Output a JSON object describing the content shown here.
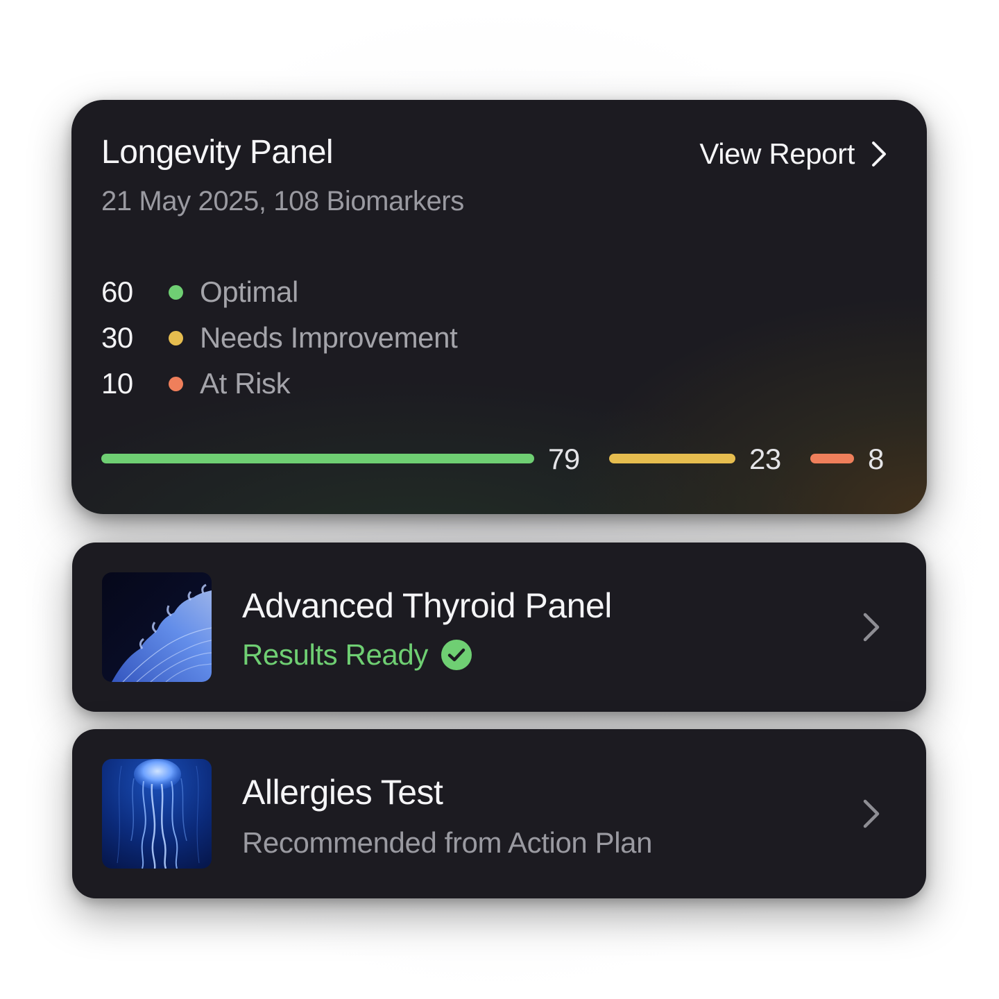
{
  "colors": {
    "optimal": "#6fcf73",
    "needs_improvement": "#e6bd4f",
    "at_risk": "#ef7f5b",
    "card_background": "#1c1b21"
  },
  "longevity_panel": {
    "title": "Longevity Panel",
    "subtitle": "21 May 2025, 108 Biomarkers",
    "view_report_label": "View Report",
    "view_report_icon": "chevron-right-icon",
    "legend": [
      {
        "count": "60",
        "label": "Optimal",
        "color": "#6fcf73"
      },
      {
        "count": "30",
        "label": "Needs Improvement",
        "color": "#e6bd4f"
      },
      {
        "count": "10",
        "label": "At Risk",
        "color": "#ef7f5b"
      }
    ],
    "bars": [
      {
        "value": 79,
        "label": "79",
        "color": "#6fcf73"
      },
      {
        "value": 23,
        "label": "23",
        "color": "#e6bd4f"
      },
      {
        "value": 8,
        "label": "8",
        "color": "#ef7f5b"
      }
    ]
  },
  "tests": [
    {
      "title": "Advanced Thyroid Panel",
      "status": "Results Ready",
      "status_icon": "check-circle-icon",
      "thumbnail": "blue-organic-coral-image",
      "chevron_icon": "chevron-right-icon"
    },
    {
      "title": "Allergies Test",
      "subtitle": "Recommended from Action Plan",
      "thumbnail": "blue-jellyfish-image",
      "chevron_icon": "chevron-right-icon"
    }
  ]
}
